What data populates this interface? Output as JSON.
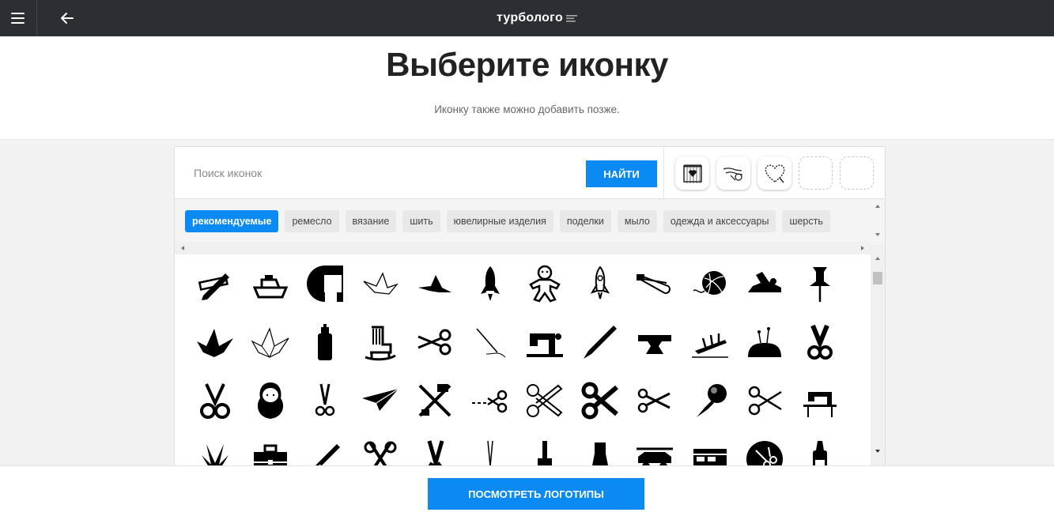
{
  "topbar": {
    "brand": "турбологo",
    "menu_icon": "hamburger-icon",
    "back_icon": "arrow-left-icon"
  },
  "header": {
    "title": "Выберите иконку",
    "subtitle": "Иконку также можно добавить позже."
  },
  "search": {
    "placeholder": "Поиск иконок",
    "value": "",
    "button_label": "НАЙТИ"
  },
  "selected_slots": [
    {
      "icon": "knitting-frame-icon",
      "filled": true
    },
    {
      "icon": "sewing-hands-icon",
      "filled": true
    },
    {
      "icon": "stitched-heart-icon",
      "filled": true
    },
    {
      "icon": "",
      "filled": false
    },
    {
      "icon": "",
      "filled": false
    }
  ],
  "tags": [
    {
      "label": "рекомендуемые",
      "active": true
    },
    {
      "label": "ремесло",
      "active": false
    },
    {
      "label": "вязание",
      "active": false
    },
    {
      "label": "шить",
      "active": false
    },
    {
      "label": "ювелирные изделия",
      "active": false
    },
    {
      "label": "поделки",
      "active": false
    },
    {
      "label": "мыло",
      "active": false
    },
    {
      "label": "одежда и аксессуары",
      "active": false
    },
    {
      "label": "шерсть",
      "active": false
    }
  ],
  "icons": [
    "ruler-pencil-icon",
    "boat-icon",
    "letter-c-logo-icon",
    "origami-bird-outline-icon",
    "origami-bird-icon",
    "rocket-icon",
    "gingerbread-man-icon",
    "rocket-outline-icon",
    "safety-pin-icon",
    "yarn-ball-icon",
    "hand-plane-icon",
    "push-pin-icon",
    "origami-crane-icon",
    "origami-crane-outline-icon",
    "spray-can-icon",
    "rocking-chair-icon",
    "scissors-icon",
    "needle-thread-icon",
    "sewing-machine-icon",
    "craft-knife-icon",
    "anvil-icon",
    "sinking-ship-icon",
    "pin-cushion-icon",
    "scissors-handles-icon",
    "scissors-open-icon",
    "matryoshka-icon",
    "small-scissors-icon",
    "paper-plane-icon",
    "tools-cross-icon",
    "cut-line-scissors-icon",
    "scissors-outline-icon",
    "scissors-bold-icon",
    "scissors-small-icon",
    "push-pin-round-icon",
    "scissors-sketch-icon",
    "sewing-machine-table-icon",
    "origami-plant-icon",
    "toolbox-icon",
    "craft-blade-icon",
    "crossed-scissors-icon",
    "scissors-vertical-icon",
    "thin-scissors-icon",
    "paint-brush-icon",
    "putty-knife-icon",
    "kayak-car-icon",
    "camper-car-icon",
    "scissors-circle-icon",
    "glue-bottle-icon"
  ],
  "cta": {
    "label": "ПОСМОТРЕТЬ ЛОГОТИПЫ"
  },
  "colors": {
    "accent": "#0b8af4",
    "topbar": "#2b2e33"
  }
}
